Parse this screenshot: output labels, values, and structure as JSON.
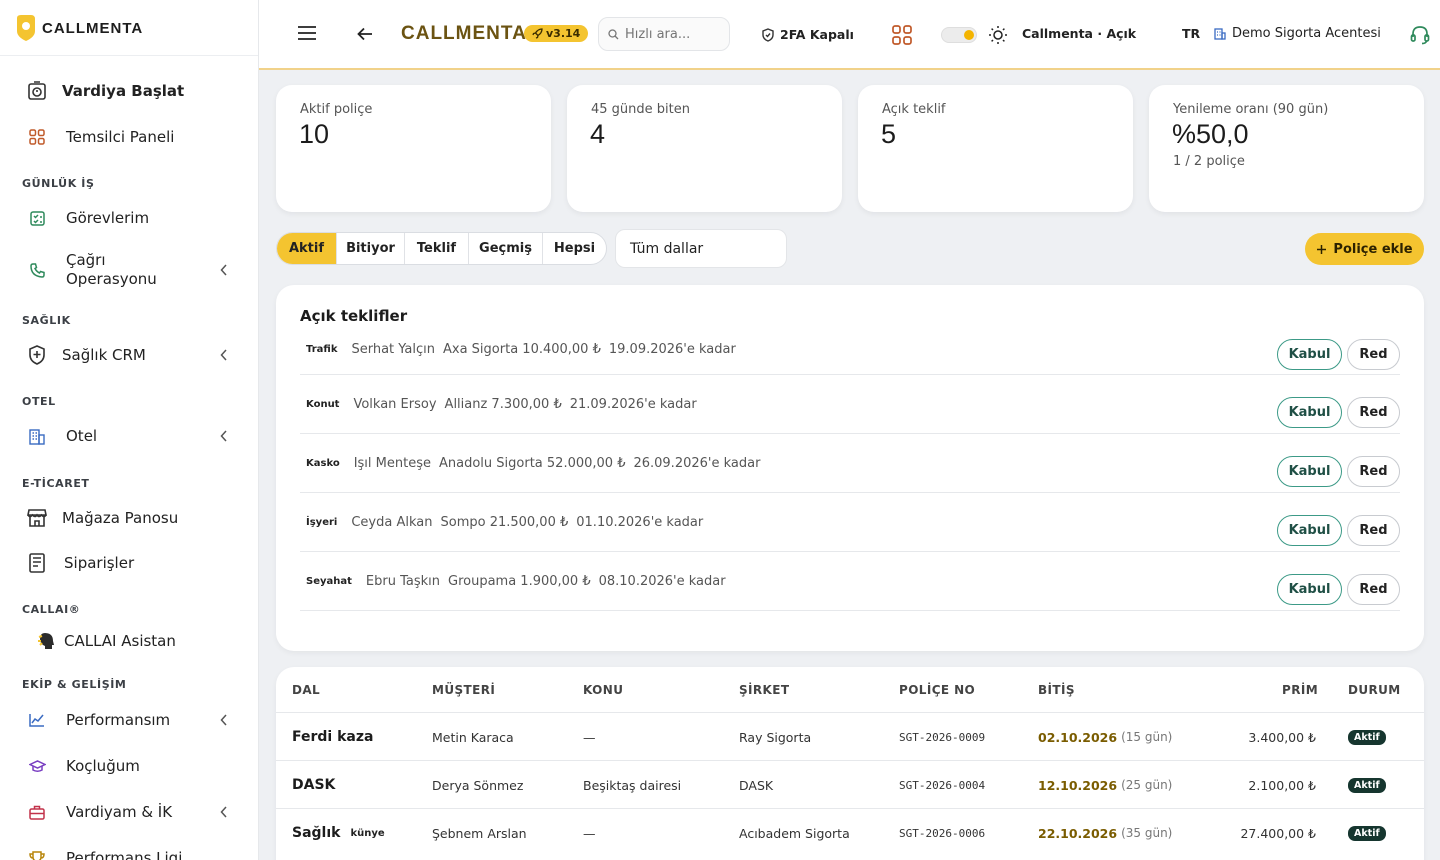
{
  "sidebar": {
    "logo_text": "CALLMENTA",
    "start_shift": "Vardiya Başlat",
    "agent_panel": "Temsilci Paneli",
    "sections": {
      "daily": "GÜNLÜK İŞ",
      "health": "SAĞLIK",
      "hotel": "OTEL",
      "ecom": "E-TİCARET",
      "callai": "CALLAI®",
      "team": "EKİP & GELİŞİM"
    },
    "items": {
      "tasks": "Görevlerim",
      "call_ops": "Çağrı Operasyonu",
      "health_crm": "Sağlık CRM",
      "hotel": "Otel",
      "store": "Mağaza Panosu",
      "orders": "Siparişler",
      "assistant": "CALLAI Asistan",
      "performance": "Performansım",
      "coaching": "Koçluğum",
      "shift_hr": "Vardiyam & İK",
      "league": "Performans Ligi"
    }
  },
  "header": {
    "brand": "CALLMENTA",
    "version": "v3.14",
    "search_placeholder": "Hızlı ara...",
    "twofa": "2FA Kapalı",
    "status": "Callmenta · Açık",
    "lang": "TR",
    "agency": "Demo Sigorta Acentesi"
  },
  "stats": [
    {
      "label": "Aktif poliçe",
      "value": "10",
      "sub": ""
    },
    {
      "label": "45 günde biten",
      "value": "4",
      "sub": ""
    },
    {
      "label": "Açık teklif",
      "value": "5",
      "sub": ""
    },
    {
      "label": "Yenileme oranı (90 gün)",
      "value": "%50,0",
      "sub": "1 / 2 poliçe"
    }
  ],
  "tabs": [
    "Aktif",
    "Bitiyor",
    "Teklif",
    "Geçmiş",
    "Hepsi"
  ],
  "filter": {
    "branch": "Tüm dallar"
  },
  "add_button": "Poliçe ekle",
  "offers": {
    "title": "Açık teklifler",
    "accept": "Kabul",
    "reject": "Red",
    "rows": [
      {
        "cat": "Trafik",
        "name": "Serhat Yalçın",
        "detail": "Axa Sigorta 10.400,00 ₺",
        "until": "19.09.2026'e kadar"
      },
      {
        "cat": "Konut",
        "name": "Volkan Ersoy",
        "detail": "Allianz 7.300,00 ₺",
        "until": "21.09.2026'e kadar"
      },
      {
        "cat": "Kasko",
        "name": "Işıl Menteşe",
        "detail": "Anadolu Sigorta 52.000,00 ₺",
        "until": "26.09.2026'e kadar"
      },
      {
        "cat": "İşyeri",
        "name": "Ceyda Alkan",
        "detail": "Sompo 21.500,00 ₺",
        "until": "01.10.2026'e kadar"
      },
      {
        "cat": "Seyahat",
        "name": "Ebru Taşkın",
        "detail": "Groupama 1.900,00 ₺",
        "until": "08.10.2026'e kadar"
      }
    ]
  },
  "table": {
    "headers": {
      "dal": "DAL",
      "musteri": "MÜŞTERİ",
      "konu": "KONU",
      "sirket": "ŞİRKET",
      "police": "POLİÇE NO",
      "bitis": "BİTİŞ",
      "prim": "PRİM",
      "durum": "DURUM"
    },
    "rows": [
      {
        "dal": "Ferdi kaza",
        "tag": "",
        "musteri": "Metin Karaca",
        "konu": "—",
        "sirket": "Ray Sigorta",
        "police": "SGT-2026-0009",
        "bitis": "02.10.2026",
        "kalan": "(15 gün)",
        "prim": "3.400,00 ₺",
        "durum": "Aktif"
      },
      {
        "dal": "DASK",
        "tag": "",
        "musteri": "Derya Sönmez",
        "konu": "Beşiktaş dairesi",
        "sirket": "DASK",
        "police": "SGT-2026-0004",
        "bitis": "12.10.2026",
        "kalan": "(25 gün)",
        "prim": "2.100,00 ₺",
        "durum": "Aktif"
      },
      {
        "dal": "Sağlık",
        "tag": "künye",
        "musteri": "Şebnem Arslan",
        "konu": "—",
        "sirket": "Acıbadem Sigorta",
        "police": "SGT-2026-0006",
        "bitis": "22.10.2026",
        "kalan": "(35 gün)",
        "prim": "27.400,00 ₺",
        "durum": "Aktif"
      }
    ]
  },
  "colors": {
    "accent": "#f4c430",
    "success": "#3c9a87",
    "badge": "#16362f",
    "brand_text": "#6b5312"
  }
}
